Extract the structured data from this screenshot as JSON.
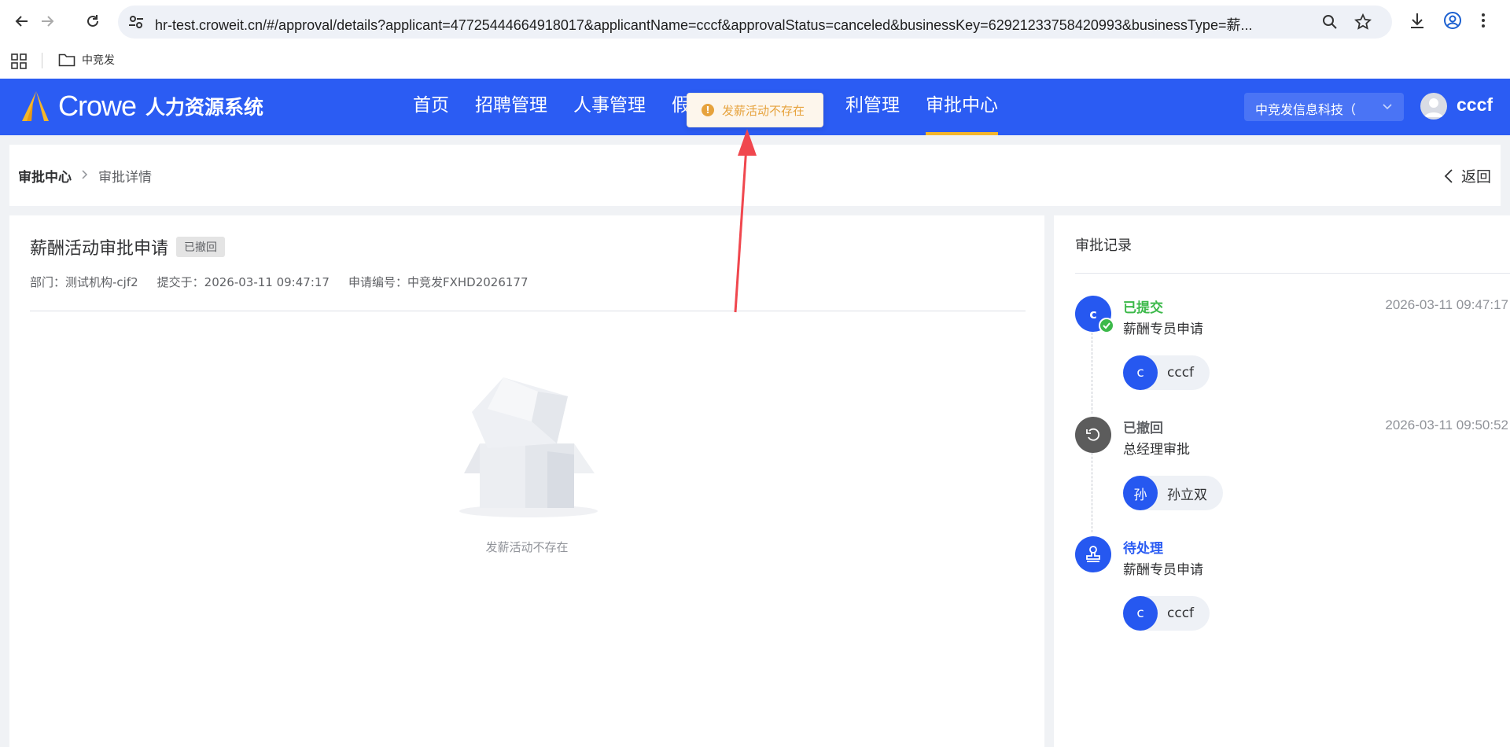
{
  "browser": {
    "url": "hr-test.croweit.cn/#/approval/details?applicant=47725444664918017&applicantName=cccf&approvalStatus=canceled&businessKey=62921233758420993&businessType=薪...",
    "bookmark_folder": "中竞发"
  },
  "header": {
    "logo_word": "Crowe",
    "system_name": "人力资源系统",
    "nav": [
      {
        "label": "首页"
      },
      {
        "label": "招聘管理"
      },
      {
        "label": "人事管理"
      },
      {
        "label": "假"
      },
      {
        "label": "利管理"
      },
      {
        "label": "审批中心",
        "active": true
      }
    ],
    "company_select": "中竞发信息科技（",
    "username": "cccf",
    "accent_color": "#2b5cf3"
  },
  "toast": {
    "message": "发薪活动不存在",
    "icon": "warning-icon"
  },
  "breadcrumb": {
    "root": "审批中心",
    "current": "审批详情",
    "back_label": "返回"
  },
  "detail": {
    "title": "薪酬活动审批申请",
    "status_tag": "已撤回",
    "department": "部门：测试机构-cjf2",
    "submitted": "提交于：2026-03-11 09:47:17",
    "application_no": "申请编号：中竞发FXHD2026177",
    "empty_text": "发薪活动不存在"
  },
  "records": {
    "title": "审批记录",
    "items": [
      {
        "status": "已提交",
        "status_color": "#3cb94a",
        "step": "薪酬专员申请",
        "time": "2026-03-11 09:47:17",
        "node_label": "c",
        "user_avatar": "c",
        "user_name": "cccf"
      },
      {
        "status": "已撤回",
        "status_color": "#606266",
        "step": "总经理审批",
        "time": "2026-03-11 09:50:52",
        "node_icon": "undo-icon",
        "user_avatar": "孙",
        "user_name": "孙立双"
      },
      {
        "status": "待处理",
        "status_color": "#2b5cf3",
        "step": "薪酬专员申请",
        "node_icon": "stamp-icon",
        "user_avatar": "c",
        "user_name": "cccf"
      }
    ]
  }
}
